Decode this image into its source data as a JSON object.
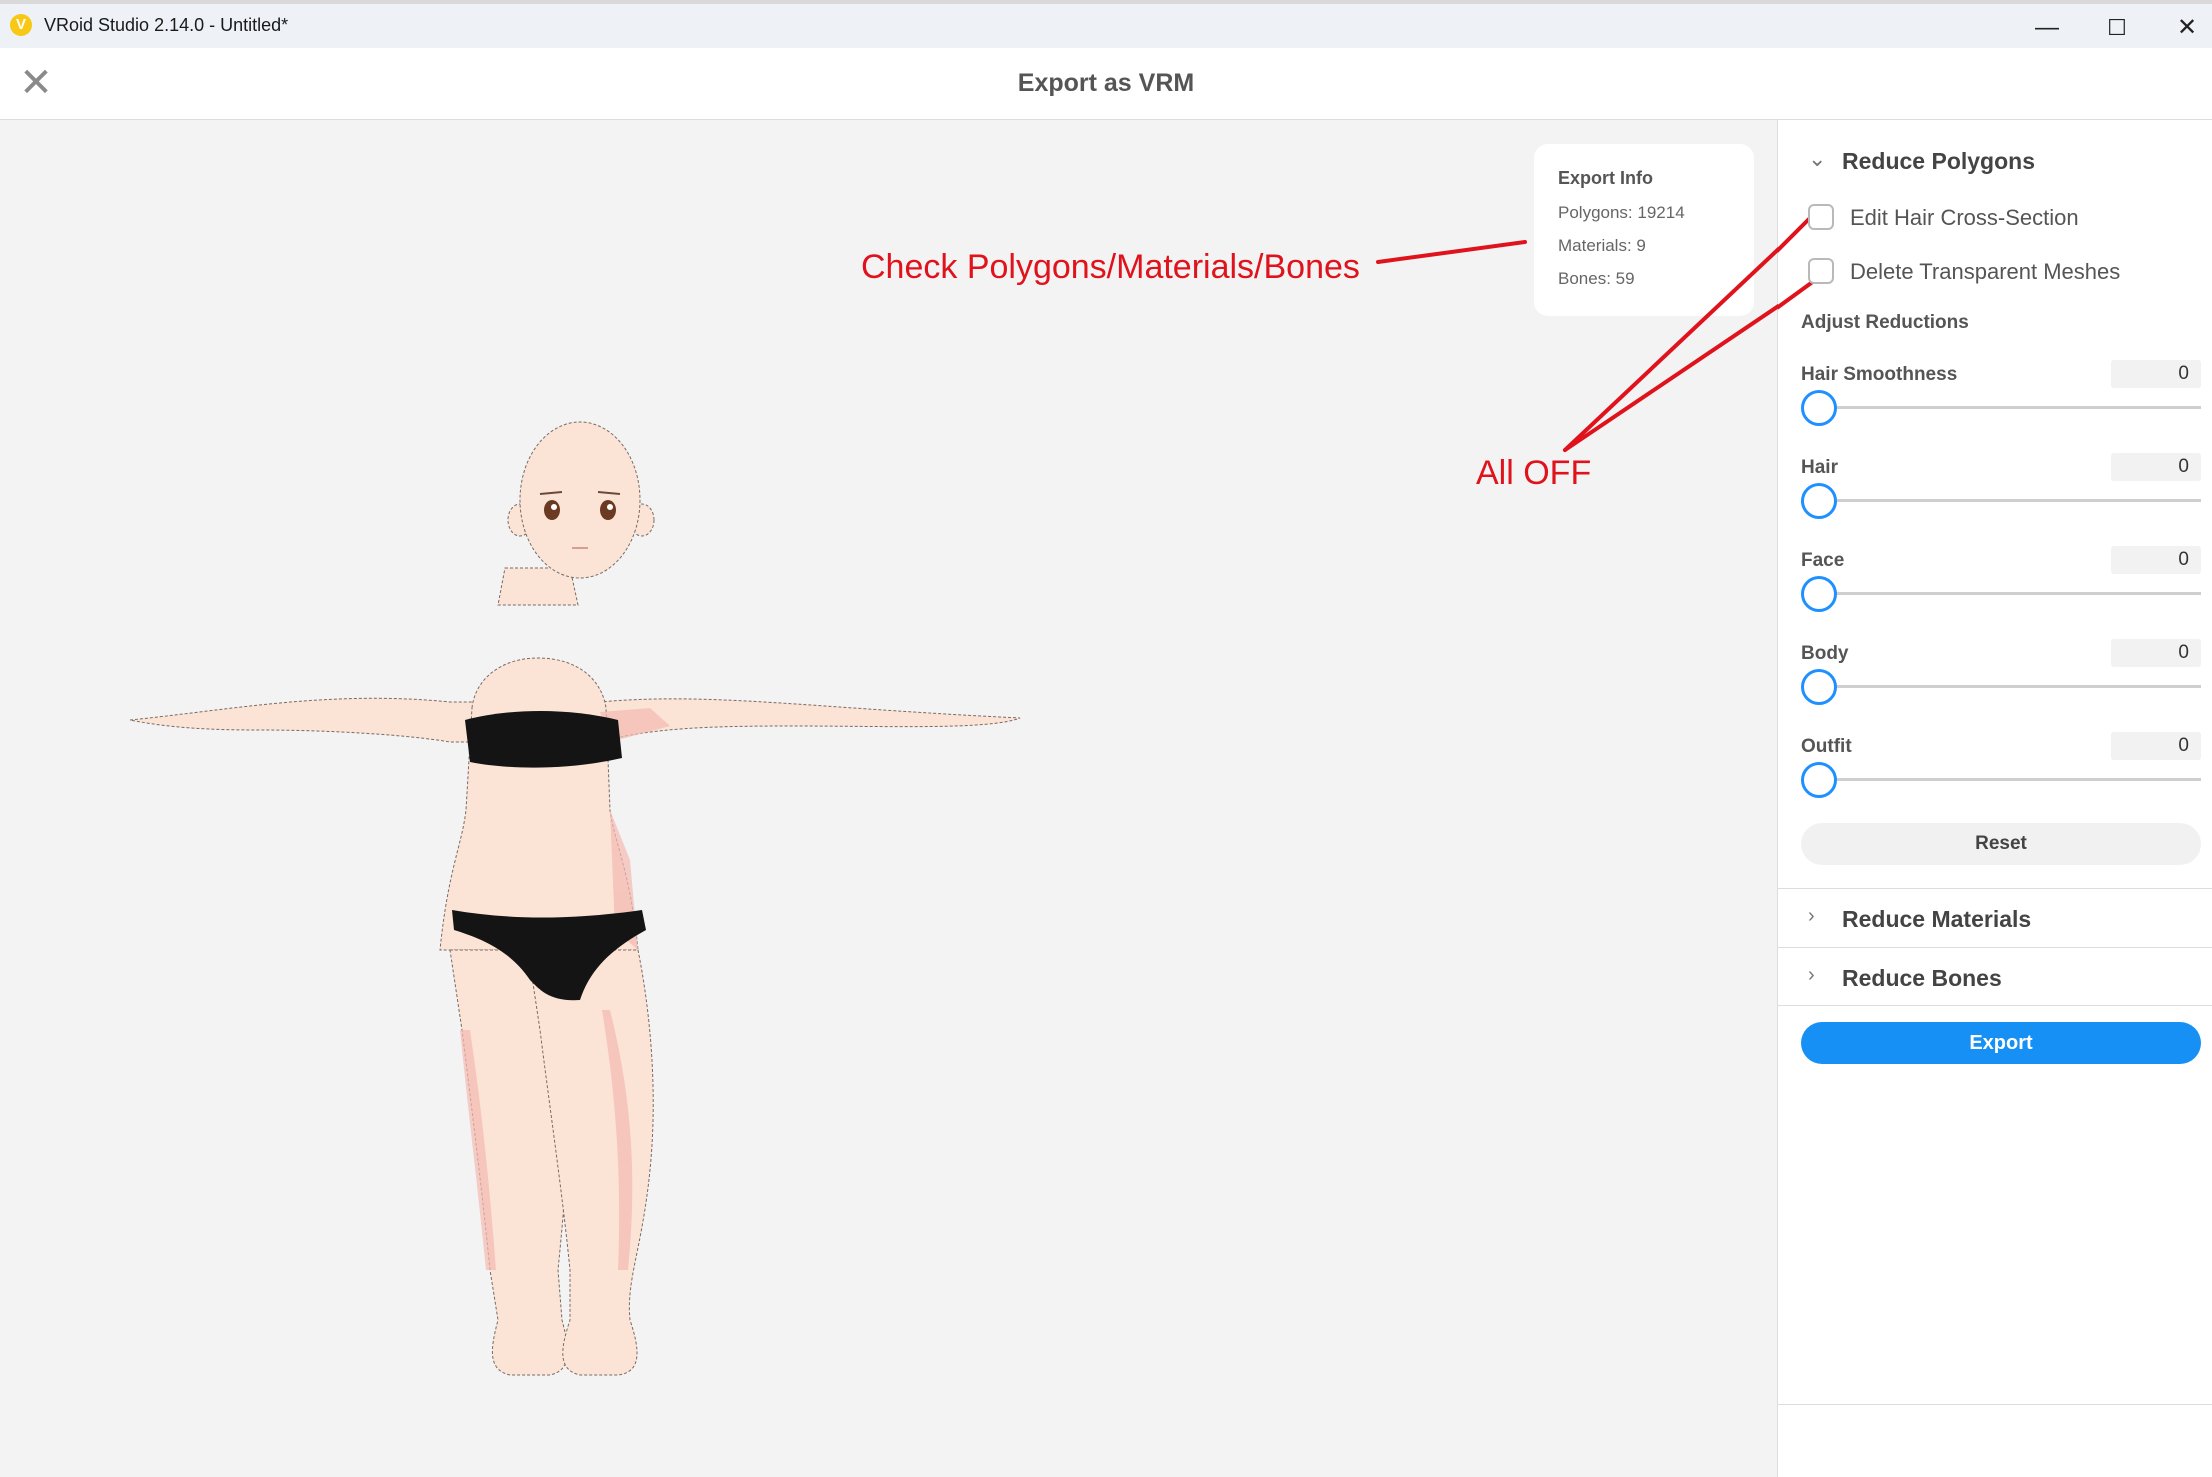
{
  "window": {
    "title": "VRoid Studio 2.14.0 - Untitled*",
    "app_icon": "vroid-logo-icon",
    "controls": {
      "minimize": "—",
      "maximize": "☐",
      "close": "✕"
    }
  },
  "dialog": {
    "title": "Export as VRM",
    "close_glyph": "✕"
  },
  "export_info": {
    "title": "Export Info",
    "polygons": "Polygons: 19214",
    "materials": "Materials: 9",
    "bones": "Bones: 59"
  },
  "annotations": {
    "check_label": "Check Polygons/Materials/Bones",
    "off_label": "All OFF",
    "color": "#e0121b"
  },
  "panel": {
    "reduce_polygons": {
      "label": "Reduce Polygons",
      "expanded": true,
      "checkboxes": [
        {
          "label": "Edit Hair Cross-Section",
          "checked": false
        },
        {
          "label": "Delete Transparent Meshes",
          "checked": false
        }
      ],
      "adjust_title": "Adjust Reductions",
      "sliders": [
        {
          "label": "Hair Smoothness",
          "value": "0"
        },
        {
          "label": "Hair",
          "value": "0"
        },
        {
          "label": "Face",
          "value": "0"
        },
        {
          "label": "Body",
          "value": "0"
        },
        {
          "label": "Outfit",
          "value": "0"
        }
      ],
      "reset_label": "Reset"
    },
    "reduce_materials": {
      "label": "Reduce Materials",
      "expanded": false
    },
    "reduce_bones": {
      "label": "Reduce Bones",
      "expanded": false
    },
    "export_label": "Export",
    "accent_color": "#1690f5"
  }
}
